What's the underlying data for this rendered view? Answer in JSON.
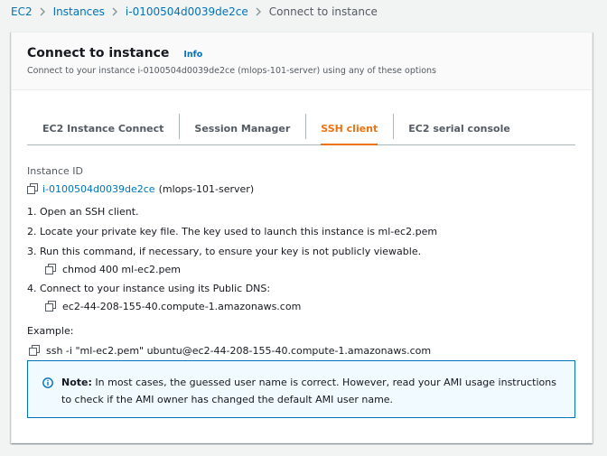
{
  "breadcrumb": {
    "items": [
      "EC2",
      "Instances",
      "i-0100504d0039de2ce"
    ],
    "current": "Connect to instance"
  },
  "header": {
    "title": "Connect to instance",
    "info_link": "Info",
    "subtitle": "Connect to your instance i-0100504d0039de2ce (mlops-101-server) using any of these options"
  },
  "tabs": [
    {
      "label": "EC2 Instance Connect",
      "active": false
    },
    {
      "label": "Session Manager",
      "active": false
    },
    {
      "label": "SSH client",
      "active": true
    },
    {
      "label": "EC2 serial console",
      "active": false
    }
  ],
  "ssh": {
    "instance_id_label": "Instance ID",
    "instance_id": "i-0100504d0039de2ce",
    "instance_name": "(mlops-101-server)",
    "steps": [
      "1. Open an SSH client.",
      "2. Locate your private key file. The key used to launch this instance is ml-ec2.pem",
      "3. Run this command, if necessary, to ensure your key is not publicly viewable.",
      "4. Connect to your instance using its Public DNS:"
    ],
    "chmod_command": "chmod 400 ml-ec2.pem",
    "public_dns": "ec2-44-208-155-40.compute-1.amazonaws.com",
    "example_label": "Example:",
    "example_command": "ssh -i \"ml-ec2.pem\" ubuntu@ec2-44-208-155-40.compute-1.amazonaws.com"
  },
  "note": {
    "label": "Note:",
    "text": " In most cases, the guessed user name is correct. However, read your AMI usage instructions to check if the AMI owner has changed the default AMI user name."
  },
  "colors": {
    "link": "#0073bb",
    "active_tab": "#ec7211",
    "note_background": "#f1faff",
    "note_border": "#0073bb"
  },
  "icons": {
    "breadcrumb_separator": "chevron-right-icon",
    "copy": "copy-icon",
    "note": "info-circle-icon"
  }
}
